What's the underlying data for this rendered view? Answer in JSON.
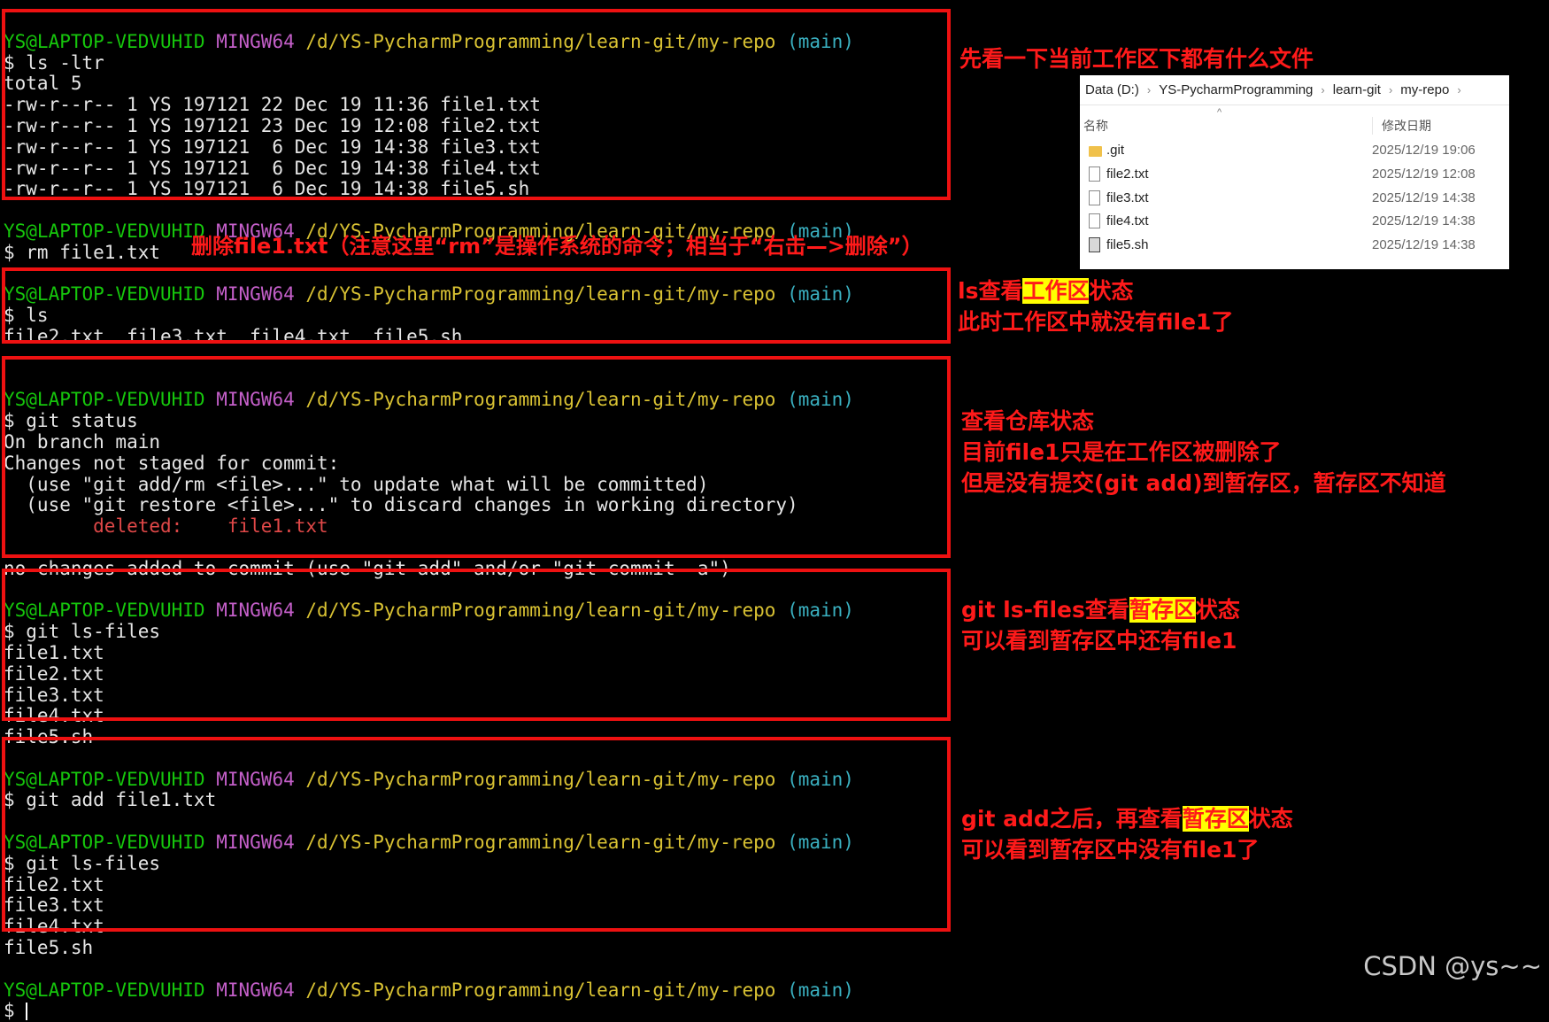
{
  "prompt": {
    "user": "YS@LAPTOP-VEDVUHID",
    "shell": "MINGW64",
    "path": "/d/YS-PycharmProgramming/learn-git/my-repo",
    "branch": "(main)"
  },
  "terminal": {
    "l1": "$ ls -ltr",
    "l2": "total 5",
    "l3": "-rw-r--r-- 1 YS 197121 22 Dec 19 11:36 file1.txt",
    "l4": "-rw-r--r-- 1 YS 197121 23 Dec 19 12:08 file2.txt",
    "l5": "-rw-r--r-- 1 YS 197121  6 Dec 19 14:38 file3.txt",
    "l6": "-rw-r--r-- 1 YS 197121  6 Dec 19 14:38 file4.txt",
    "l7": "-rw-r--r-- 1 YS 197121  6 Dec 19 14:38 file5.sh",
    "l10": "$ rm file1.txt",
    "l13": "$ ls",
    "l14": "file2.txt  file3.txt  file4.txt  file5.sh",
    "l17": "$ git status",
    "l18": "On branch main",
    "l19": "Changes not staged for commit:",
    "l20": "  (use \"git add/rm <file>...\" to update what will be committed)",
    "l21": "  (use \"git restore <file>...\" to discard changes in working directory)",
    "l22_pre": "        ",
    "l22": "deleted:    file1.txt",
    "l24": "no changes added to commit (use \"git add\" and/or \"git commit -a\")",
    "l27": "$ git ls-files",
    "l28": "file1.txt",
    "l29": "file2.txt",
    "l30": "file3.txt",
    "l31": "file4.txt",
    "l32": "file5.sh",
    "l35": "$ git add file1.txt",
    "l38": "$ git ls-files",
    "l39": "file2.txt",
    "l40": "file3.txt",
    "l41": "file4.txt",
    "l42": "file5.sh",
    "l45": "$ "
  },
  "annotations": {
    "a1": "先看一下当前工作区下都有什么文件",
    "a2": "删除file1.txt（注意这里“rm”是操作系统的命令；相当于“右击—>删除”）",
    "a3_pre": "ls查看",
    "a3_hl": "工作区",
    "a3_post": "状态",
    "a3b": "此时工作区中就没有file1了",
    "a4a": "查看仓库状态",
    "a4b": "目前file1只是在工作区被删除了",
    "a4c": "但是没有提交(git add)到暂存区，暂存区不知道",
    "a5_pre": "git ls-files查看",
    "a5_hl": "暂存区",
    "a5_post": "状态",
    "a5b": "可以看到暂存区中还有file1",
    "a6_pre": "git add之后，再查看",
    "a6_hl": "暂存区",
    "a6_post": "状态",
    "a6b": "可以看到暂存区中没有file1了"
  },
  "explorer": {
    "crumbs": [
      "Data (D:)",
      "YS-PycharmProgramming",
      "learn-git",
      "my-repo"
    ],
    "col_name": "名称",
    "col_date": "修改日期",
    "files": [
      {
        "name": ".git",
        "date": "2025/12/19 19:06",
        "icon": "folder-icon"
      },
      {
        "name": "file2.txt",
        "date": "2025/12/19 12:08",
        "icon": "text-file-icon"
      },
      {
        "name": "file3.txt",
        "date": "2025/12/19 14:38",
        "icon": "text-file-icon"
      },
      {
        "name": "file4.txt",
        "date": "2025/12/19 14:38",
        "icon": "text-file-icon"
      },
      {
        "name": "file5.sh",
        "date": "2025/12/19 14:38",
        "icon": "script-file-icon"
      }
    ]
  },
  "watermark": "CSDN @ys~~"
}
